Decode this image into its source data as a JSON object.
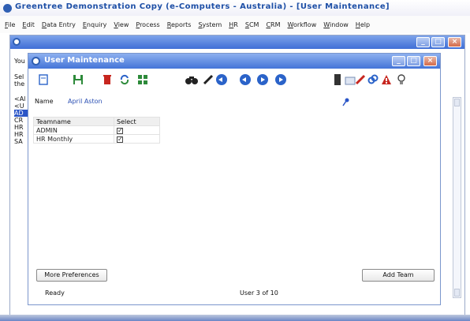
{
  "app": {
    "title": "Greentree Demonstration Copy (e-Computers - Australia) - [User Maintenance]"
  },
  "menubar": {
    "items": [
      "File",
      "Edit",
      "Data Entry",
      "Enquiry",
      "View",
      "Process",
      "Reports",
      "System",
      "HR",
      "SCM",
      "CRM",
      "Workflow",
      "Window",
      "Help"
    ]
  },
  "background_window": {
    "title": "",
    "left_fragments": [
      "You",
      "Sel",
      "the",
      "<Al",
      "<U",
      "AD",
      "CR",
      "HR",
      "HR",
      "SA"
    ]
  },
  "dialog": {
    "title": "User Maintenance",
    "toolbar": {
      "icons": [
        "new-document-icon",
        "save-icon",
        "delete-icon",
        "refresh-icon",
        "tree-icon",
        "find-icon",
        "edit-icon",
        "first-record-icon",
        "previous-record-icon",
        "next-record-icon",
        "last-record-icon",
        "notes-icon",
        "attach-icon",
        "red-pen-icon",
        "link-icon",
        "warning-icon",
        "help-bulb-icon"
      ]
    },
    "name_label": "Name",
    "name_value": "April Aston",
    "table": {
      "headers": [
        "Teamname",
        "Select"
      ],
      "rows": [
        {
          "teamname": "ADMIN",
          "selected": true
        },
        {
          "teamname": "HR Monthly",
          "selected": true
        }
      ]
    },
    "buttons": {
      "more_preferences": "More Preferences",
      "add_team": "Add Team"
    },
    "status": {
      "left": "Ready",
      "center": "User 3 of 10"
    }
  },
  "colors": {
    "title_blue": "#1d4fa6",
    "titlebar_gradient_top": "#8db0ef",
    "titlebar_gradient_bottom": "#4474d8",
    "nav_blue": "#2b63c9",
    "delete_red": "#c7261f",
    "save_green": "#2d8a3a"
  }
}
